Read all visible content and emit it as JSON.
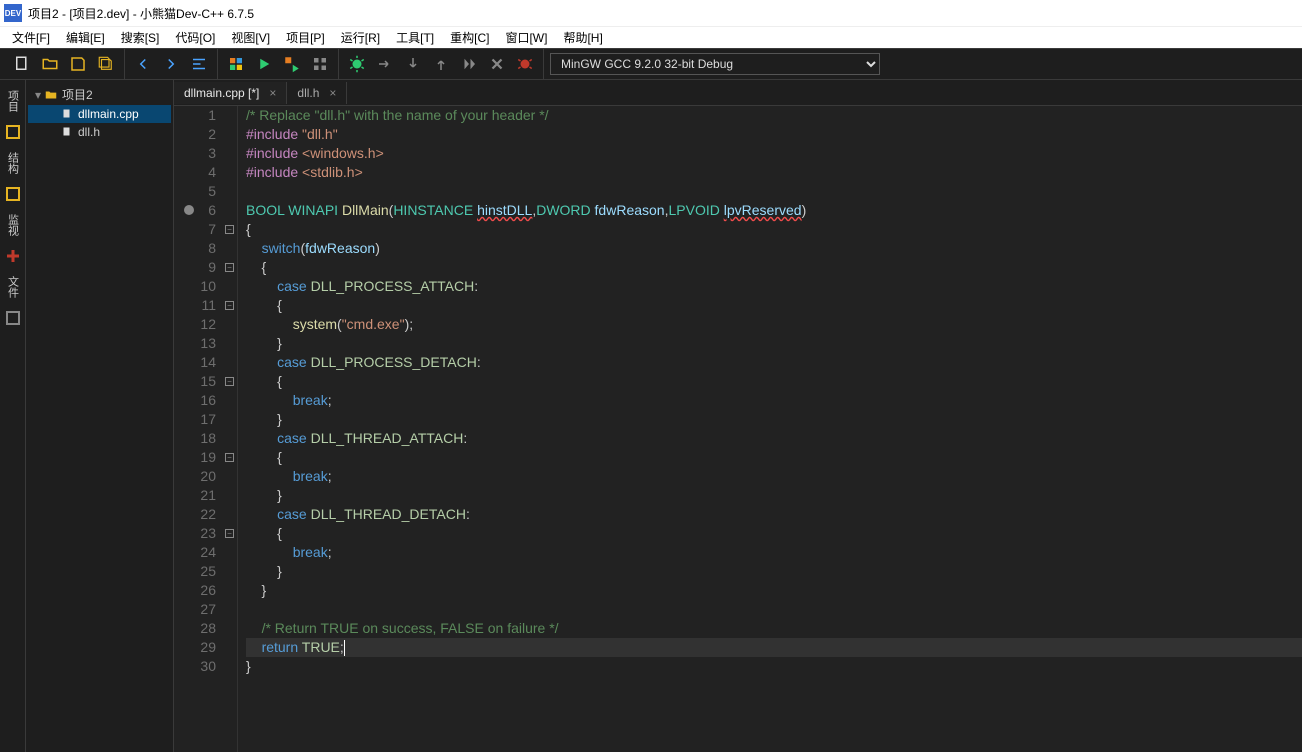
{
  "window": {
    "title": "项目2 - [项目2.dev] - 小熊猫Dev-C++  6.7.5",
    "app_icon_text": "DEV"
  },
  "menu": [
    "文件[F]",
    "编辑[E]",
    "搜索[S]",
    "代码[O]",
    "视图[V]",
    "项目[P]",
    "运行[R]",
    "工具[T]",
    "重构[C]",
    "窗口[W]",
    "帮助[H]"
  ],
  "toolbar": {
    "compiler": "MinGW GCC 9.2.0 32-bit Debug"
  },
  "dock_tabs": [
    "项目",
    "结构",
    "监视",
    "文件"
  ],
  "project_tree": {
    "root": "项目2",
    "files": [
      "dllmain.cpp",
      "dll.h"
    ]
  },
  "tabs": [
    {
      "label": "dllmain.cpp [*]",
      "active": true
    },
    {
      "label": "dll.h",
      "active": false
    }
  ],
  "code": {
    "lines": [
      {
        "n": 1,
        "html": "<span class='c-comment'>/* Replace \"dll.h\" with the name of your header */</span>"
      },
      {
        "n": 2,
        "html": "<span class='c-preproc'>#include</span> <span class='c-string'>\"dll.h\"</span>"
      },
      {
        "n": 3,
        "html": "<span class='c-preproc'>#include</span> <span class='c-string'>&lt;windows.h&gt;</span>"
      },
      {
        "n": 4,
        "html": "<span class='c-preproc'>#include</span> <span class='c-string'>&lt;stdlib.h&gt;</span>"
      },
      {
        "n": 5,
        "html": ""
      },
      {
        "n": 6,
        "bp": true,
        "html": "<span class='c-type'>BOOL</span> <span class='c-type'>WINAPI</span> <span class='c-func'>DllMain</span>(<span class='c-type'>HINSTANCE</span> <span class='c-param c-err'>hinstDLL</span>,<span class='c-type'>DWORD</span> <span class='c-param'>fdwReason</span>,<span class='c-type'>LPVOID</span> <span class='c-param c-err'>lpvReserved</span>)"
      },
      {
        "n": 7,
        "fold": true,
        "html": "{"
      },
      {
        "n": 8,
        "html": "    <span class='c-keyword'>switch</span>(<span class='c-param'>fdwReason</span>)"
      },
      {
        "n": 9,
        "fold": true,
        "html": "    {"
      },
      {
        "n": 10,
        "html": "        <span class='c-keyword'>case</span> <span class='c-const'>DLL_PROCESS_ATTACH</span>:"
      },
      {
        "n": 11,
        "fold": true,
        "html": "        {"
      },
      {
        "n": 12,
        "html": "            <span class='c-func'>system</span>(<span class='c-string'>\"cmd.exe\"</span>);"
      },
      {
        "n": 13,
        "html": "        }"
      },
      {
        "n": 14,
        "html": "        <span class='c-keyword'>case</span> <span class='c-const'>DLL_PROCESS_DETACH</span>:"
      },
      {
        "n": 15,
        "fold": true,
        "html": "        {"
      },
      {
        "n": 16,
        "html": "            <span class='c-keyword'>break</span>;"
      },
      {
        "n": 17,
        "html": "        }"
      },
      {
        "n": 18,
        "html": "        <span class='c-keyword'>case</span> <span class='c-const'>DLL_THREAD_ATTACH</span>:"
      },
      {
        "n": 19,
        "fold": true,
        "html": "        {"
      },
      {
        "n": 20,
        "html": "            <span class='c-keyword'>break</span>;"
      },
      {
        "n": 21,
        "html": "        }"
      },
      {
        "n": 22,
        "html": "        <span class='c-keyword'>case</span> <span class='c-const'>DLL_THREAD_DETACH</span>:"
      },
      {
        "n": 23,
        "fold": true,
        "html": "        {"
      },
      {
        "n": 24,
        "html": "            <span class='c-keyword'>break</span>;"
      },
      {
        "n": 25,
        "html": "        }"
      },
      {
        "n": 26,
        "html": "    }"
      },
      {
        "n": 27,
        "html": ""
      },
      {
        "n": 28,
        "html": "    <span class='c-comment'>/* Return TRUE on success, FALSE on failure */</span>"
      },
      {
        "n": 29,
        "current": true,
        "html": "    <span class='c-keyword'>return</span> <span class='c-const'>TRUE</span>;<span class='cursor-line'></span>"
      },
      {
        "n": 30,
        "html": "}"
      }
    ]
  }
}
